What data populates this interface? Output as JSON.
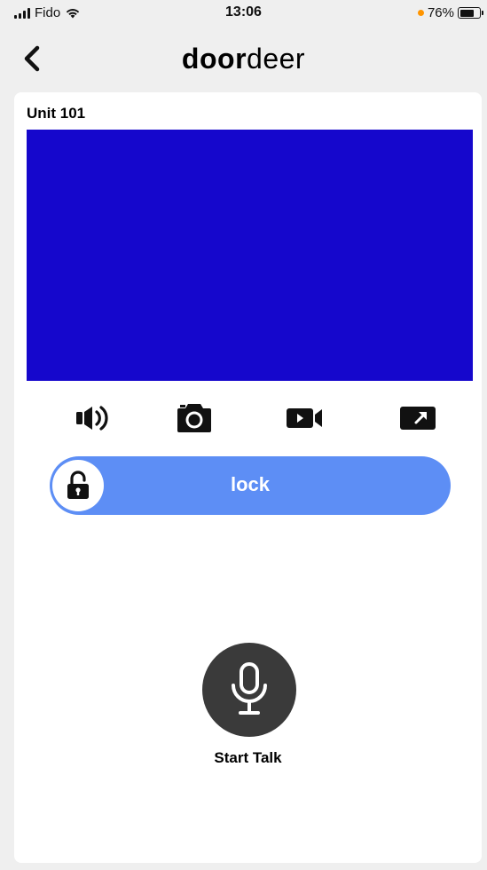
{
  "status_bar": {
    "carrier": "Fido",
    "time": "13:06",
    "battery": "76%",
    "battery_level": 0.76,
    "icons": [
      "signal-icon",
      "wifi-icon",
      "orange-dot-indicator",
      "battery-icon"
    ]
  },
  "nav": {
    "back_icon": "chevron-left-icon",
    "logo_bold": "door",
    "logo_light": "deer"
  },
  "card": {
    "unit_title": "Unit 101",
    "video_color": "#1507cc"
  },
  "controls": [
    {
      "icon": "speaker-icon"
    },
    {
      "icon": "camera-icon"
    },
    {
      "icon": "video-record-icon"
    },
    {
      "icon": "fullscreen-icon"
    }
  ],
  "lock": {
    "label": "lock",
    "icon": "unlock-icon",
    "color": "#5d8ef5"
  },
  "talk": {
    "label": "Start Talk",
    "icon": "microphone-icon"
  }
}
